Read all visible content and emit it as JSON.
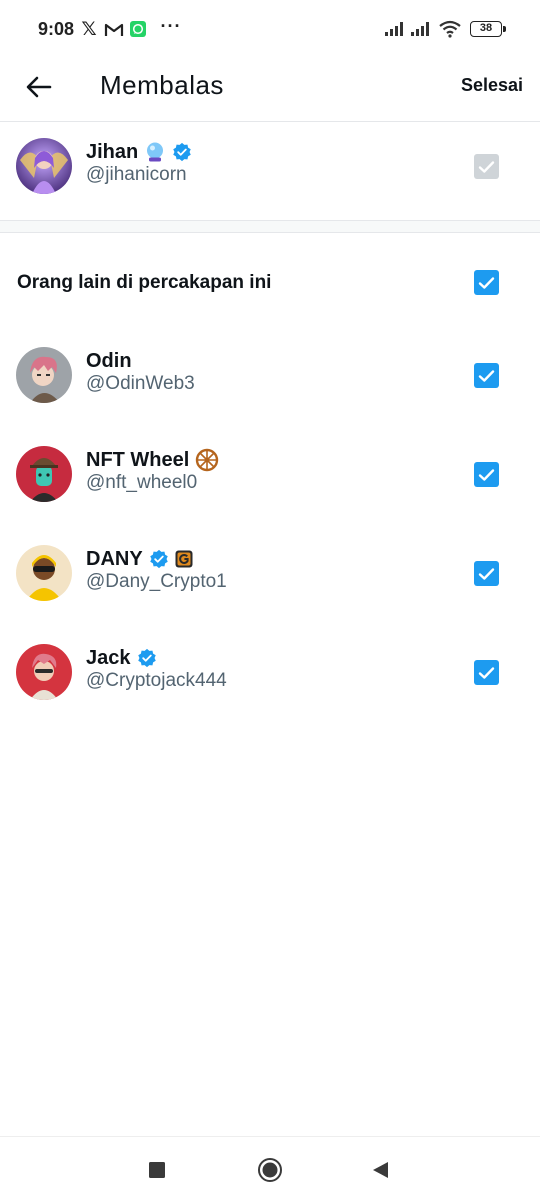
{
  "status_bar": {
    "time": "9:08",
    "left_icons": [
      "x-logo-icon",
      "gmail-icon",
      "whatsapp-icon",
      "more-dots-icon"
    ],
    "more_dots": "···",
    "x_glyph": "𝕏",
    "right_icons": [
      "signal-icon",
      "signal-icon",
      "wifi-icon",
      "battery-icon"
    ],
    "battery_level": "38"
  },
  "header": {
    "back_icon": "arrow-left-icon",
    "title": "Membalas",
    "done_label": "Selesai"
  },
  "author": {
    "name": "Jihan",
    "handle": "@jihanicorn",
    "badges": [
      "crystal-ball-emoji",
      "verified-badge-icon"
    ],
    "checked": true,
    "disabled": true
  },
  "others": {
    "label": "Orang lain di percakapan ini",
    "checked": true
  },
  "participants": [
    {
      "name": "Odin",
      "handle": "@OdinWeb3",
      "badges": [],
      "checked": true
    },
    {
      "name": "NFT Wheel",
      "handle": "@nft_wheel0",
      "badges": [
        "wheel-emoji"
      ],
      "checked": true
    },
    {
      "name": "DANY",
      "handle": "@Dany_Crypto1",
      "badges": [
        "verified-badge-icon",
        "g-affiliate-badge"
      ],
      "checked": true
    },
    {
      "name": "Jack",
      "handle": "@Cryptojack444",
      "badges": [
        "verified-badge-icon"
      ],
      "checked": true
    }
  ],
  "nav_bar": {
    "icons": [
      "recent-apps-square-icon",
      "home-circle-icon",
      "back-triangle-icon"
    ]
  },
  "colors": {
    "accent": "#1d9bf0",
    "text_primary": "#0f1419",
    "text_secondary": "#536471",
    "checkbox_disabled": "#cfd4d8"
  }
}
